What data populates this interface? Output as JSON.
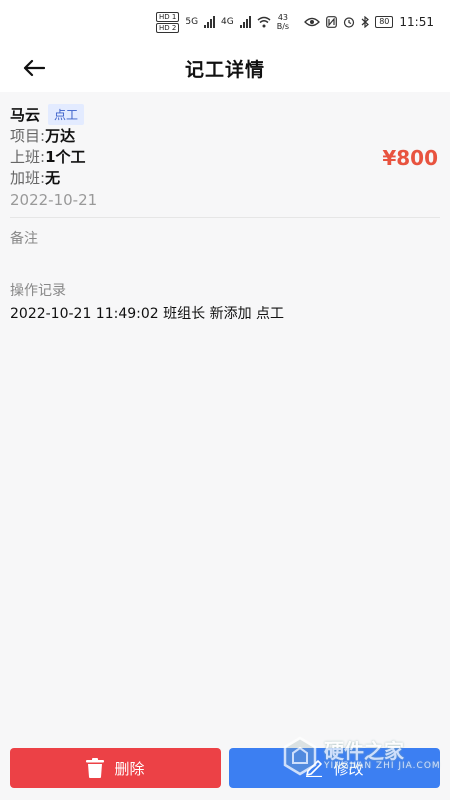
{
  "status_bar": {
    "hd1": "HD 1",
    "hd2": "HD 2",
    "sig1": "5G",
    "sig2": "4G",
    "net_speed": "43",
    "net_unit": "B/s",
    "battery": "80",
    "time": "11:51"
  },
  "header": {
    "title": "记工详情"
  },
  "record": {
    "name": "马云",
    "tag": "点工",
    "project_label": "项目:",
    "project_value": "万达",
    "shift_label": "上班:",
    "shift_value": "1个工",
    "overtime_label": "加班:",
    "overtime_value": "无",
    "date": "2022-10-21",
    "amount": "¥800"
  },
  "remark": {
    "label": "备注"
  },
  "operations": {
    "label": "操作记录",
    "entry": "2022-10-21 11:49:02 班组长 新添加 点工"
  },
  "actions": {
    "delete_label": "删除",
    "edit_label": "修改"
  },
  "watermark": {
    "cn": "硬件之家",
    "en": "YINGJIAN ZHI JIA.COM"
  },
  "colors": {
    "amount": "#e8533f",
    "delete_button": "#ec4146",
    "edit_button": "#3c7ff2",
    "tag_bg": "#e3ebff"
  }
}
